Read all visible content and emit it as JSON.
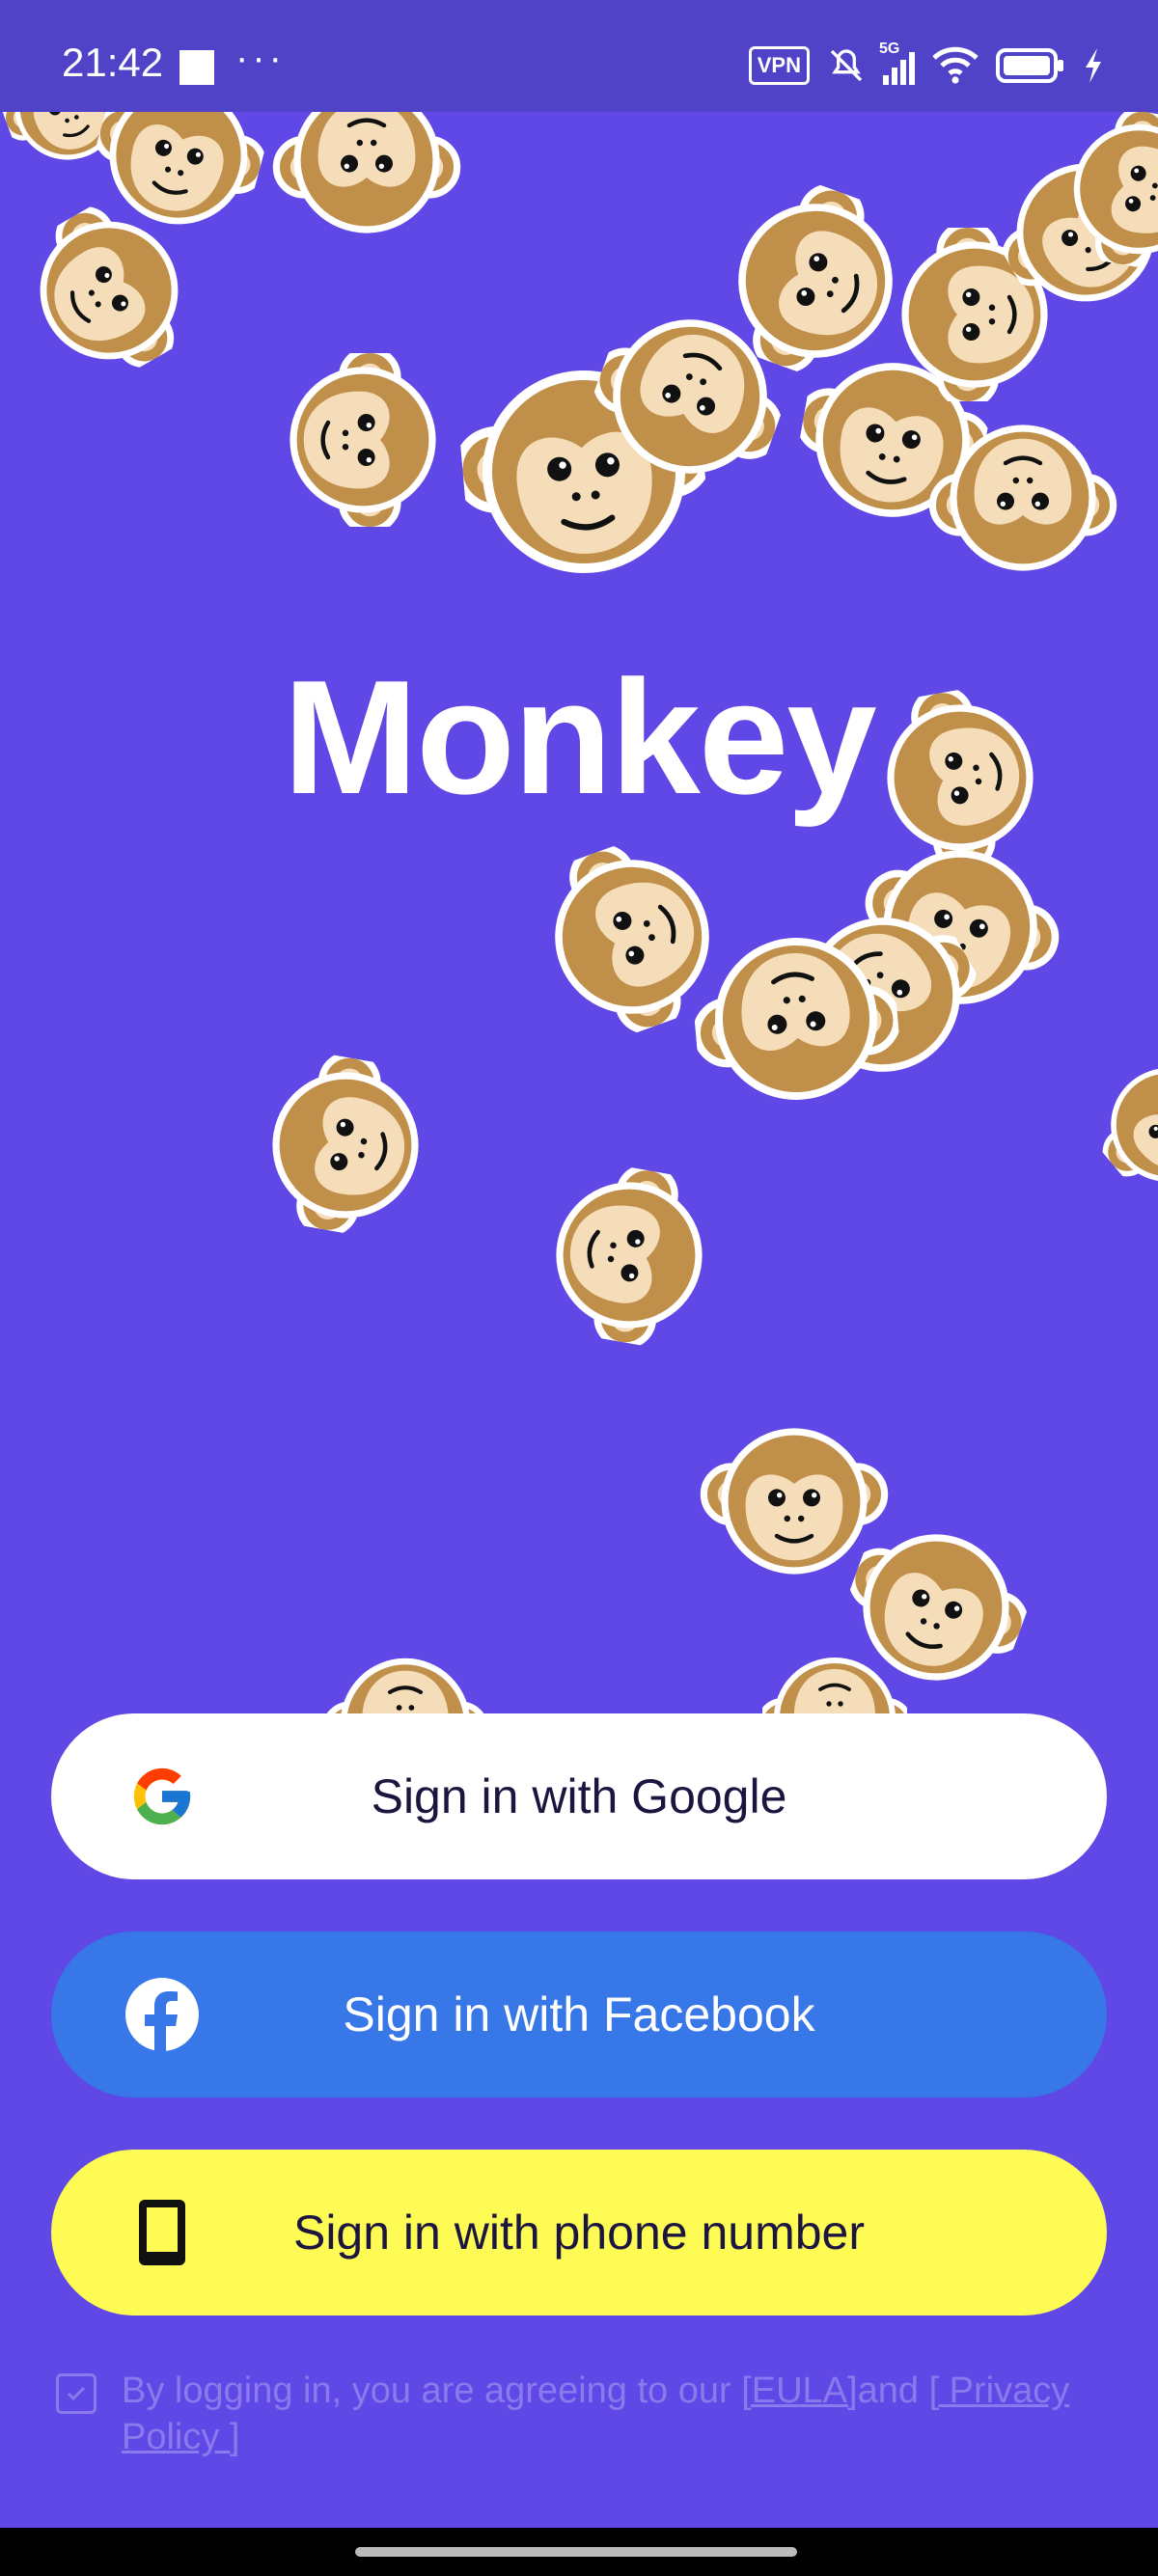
{
  "status_bar": {
    "time": "21:42",
    "vpn_label": "VPN",
    "network": "5G",
    "icons": [
      "silent-bell-icon",
      "signal-icon",
      "wifi-icon",
      "battery-icon",
      "charging-icon"
    ]
  },
  "app": {
    "title": "Monkey",
    "background_color": "#6048E6"
  },
  "buttons": {
    "google": {
      "label": "Sign in with Google",
      "icon": "google-icon",
      "color": "#FFFFFF"
    },
    "facebook": {
      "label": "Sign in with Facebook",
      "icon": "facebook-icon",
      "color": "#3777E8"
    },
    "phone": {
      "label": "Sign in with phone number",
      "icon": "phone-icon",
      "color": "#FDFB54"
    }
  },
  "consent": {
    "checked": true,
    "prefix": "By logging in, you are agreeing to our ",
    "eula_link": "[EULA]",
    "middle": "and ",
    "privacy_link": "[ Privacy Policy ]"
  }
}
